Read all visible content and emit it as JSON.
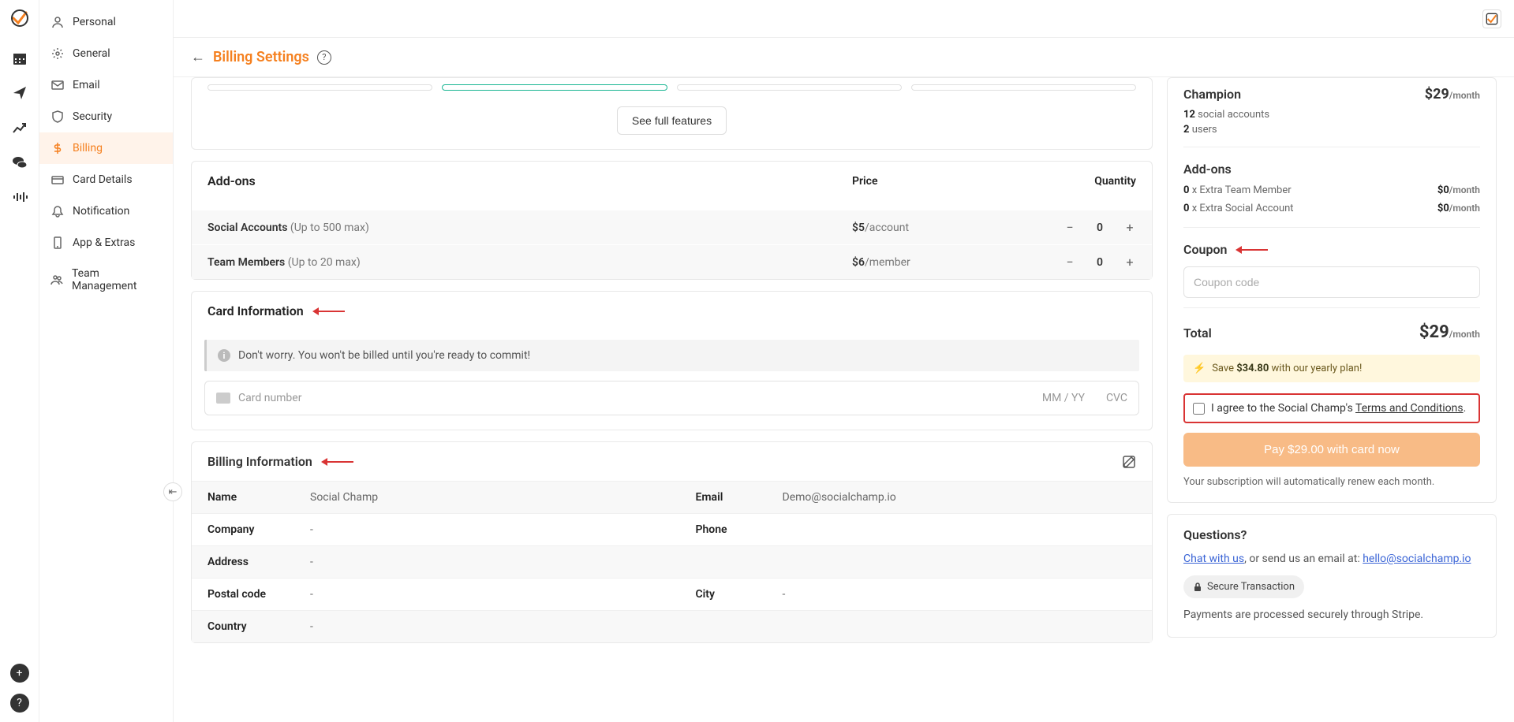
{
  "header": {
    "title": "Billing Settings"
  },
  "sidebar": {
    "items": [
      {
        "label": "Personal"
      },
      {
        "label": "General"
      },
      {
        "label": "Email"
      },
      {
        "label": "Security"
      },
      {
        "label": "Billing"
      },
      {
        "label": "Card Details"
      },
      {
        "label": "Notification"
      },
      {
        "label": "App & Extras"
      },
      {
        "label": "Team Management"
      }
    ]
  },
  "plans": {
    "see_full_features": "See full features"
  },
  "addons": {
    "title": "Add-ons",
    "col_price": "Price",
    "col_qty": "Quantity",
    "rows": [
      {
        "name": "Social Accounts",
        "hint": " (Up to 500 max)",
        "price_num": "$5",
        "price_unit": "/account",
        "qty": "0"
      },
      {
        "name": "Team Members",
        "hint": " (Up to 20 max)",
        "price_num": "$6",
        "price_unit": "/member",
        "qty": "0"
      }
    ]
  },
  "card_info": {
    "title": "Card Information",
    "banner": "Don't worry. You won't be billed until you're ready to commit!",
    "placeholder_num": "Card number",
    "placeholder_exp": "MM / YY",
    "placeholder_cvc": "CVC"
  },
  "billing_info": {
    "title": "Billing Information",
    "labels": {
      "name": "Name",
      "email": "Email",
      "company": "Company",
      "phone": "Phone",
      "address": "Address",
      "postal": "Postal code",
      "city": "City",
      "country": "Country"
    },
    "values": {
      "name": "Social Champ",
      "email": "Demo@socialchamp.io",
      "company": "-",
      "phone": "",
      "address": "-",
      "postal": "-",
      "city": "-",
      "country": "-"
    }
  },
  "summary": {
    "plan_name": "Champion",
    "plan_price": "$29",
    "plan_unit": "/month",
    "social_count": "12",
    "social_label": " social accounts",
    "users_count": "2",
    "users_label": " users",
    "addons_title": "Add-ons",
    "addon_team_qty": "0",
    "addon_team_label": " x Extra Team Member",
    "addon_team_price": "$0",
    "addon_team_unit": "/month",
    "addon_social_qty": "0",
    "addon_social_label": " x Extra Social Account",
    "addon_social_price": "$0",
    "addon_social_unit": "/month",
    "coupon_title": "Coupon",
    "coupon_placeholder": "Coupon code",
    "total_label": "Total",
    "total_price": "$29",
    "total_unit": "/month",
    "save_prefix": "Save ",
    "save_amount": "$34.80",
    "save_suffix": " with our yearly plan!",
    "agree_prefix": "I agree to the Social Champ's ",
    "agree_link": "Terms and Conditions",
    "agree_suffix": ".",
    "pay_button": "Pay $29.00 with card now",
    "renew_note": "Your subscription will automatically renew each month."
  },
  "questions": {
    "title": "Questions?",
    "chat_link": "Chat with us",
    "mid": ", or send us an email at: ",
    "email": "hello@socialchamp.io",
    "secure": "Secure Transaction",
    "stripe": "Payments are processed securely through Stripe."
  }
}
